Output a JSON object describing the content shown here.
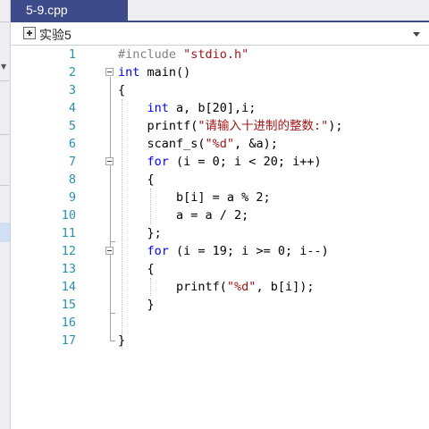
{
  "tab": {
    "title": "5-9.cpp"
  },
  "navbar": {
    "scope_label": "实验5"
  },
  "editor": {
    "lines": [
      {
        "num": "1",
        "tokens": [
          {
            "t": "#include ",
            "c": "pp"
          },
          {
            "t": "\"stdio.h\"",
            "c": "str"
          }
        ]
      },
      {
        "num": "2",
        "tokens": [
          {
            "t": "int",
            "c": "kw"
          },
          {
            "t": " main()",
            "c": "fn"
          }
        ]
      },
      {
        "num": "3",
        "tokens": [
          {
            "t": "{",
            "c": "op"
          }
        ]
      },
      {
        "num": "4",
        "tokens": [
          {
            "t": "    "
          },
          {
            "t": "int",
            "c": "kw"
          },
          {
            "t": " a, b[20],i;"
          }
        ]
      },
      {
        "num": "5",
        "tokens": [
          {
            "t": "    printf("
          },
          {
            "t": "\"请输入十进制的整数:\"",
            "c": "str"
          },
          {
            "t": ");"
          }
        ]
      },
      {
        "num": "6",
        "tokens": [
          {
            "t": "    scanf_s("
          },
          {
            "t": "\"%d\"",
            "c": "str"
          },
          {
            "t": ", &a);"
          }
        ]
      },
      {
        "num": "7",
        "tokens": [
          {
            "t": "    "
          },
          {
            "t": "for",
            "c": "kw"
          },
          {
            "t": " (i = 0; i < 20; i++)"
          }
        ]
      },
      {
        "num": "8",
        "tokens": [
          {
            "t": "    {"
          }
        ]
      },
      {
        "num": "9",
        "tokens": [
          {
            "t": "        b[i] = a % 2;"
          }
        ]
      },
      {
        "num": "10",
        "tokens": [
          {
            "t": "        a = a / 2;"
          }
        ]
      },
      {
        "num": "11",
        "tokens": [
          {
            "t": "    };"
          }
        ]
      },
      {
        "num": "12",
        "tokens": [
          {
            "t": "    "
          },
          {
            "t": "for",
            "c": "kw"
          },
          {
            "t": " (i = 19; i >= 0; i--)"
          }
        ]
      },
      {
        "num": "13",
        "tokens": [
          {
            "t": "    {"
          }
        ]
      },
      {
        "num": "14",
        "tokens": [
          {
            "t": "        printf("
          },
          {
            "t": "\"%d\"",
            "c": "str"
          },
          {
            "t": ", b[i]);"
          }
        ]
      },
      {
        "num": "15",
        "tokens": [
          {
            "t": "    }"
          }
        ]
      },
      {
        "num": "16",
        "tokens": [
          {
            "t": ""
          }
        ]
      },
      {
        "num": "17",
        "tokens": [
          {
            "t": "}"
          }
        ]
      }
    ]
  },
  "colors": {
    "tab_active": "#3d4b8a",
    "keyword": "#0000ff",
    "string": "#a31515",
    "line_number": "#2b91af",
    "preprocessor": "#808080"
  }
}
